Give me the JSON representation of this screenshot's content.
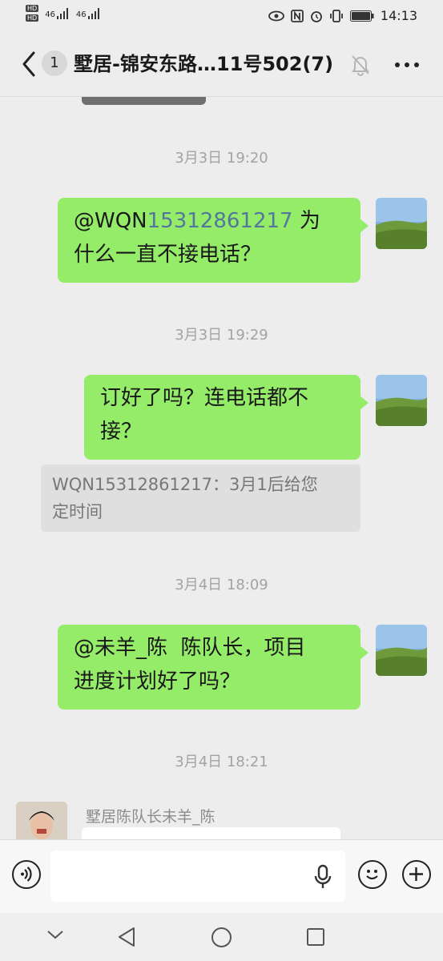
{
  "status_bar": {
    "hd1": "HD",
    "hd2": "HD",
    "signal1": "46",
    "signal2": "46",
    "time": "14:13"
  },
  "nav": {
    "unread_count": "1",
    "title": "墅居-锦安东路…11号502(7)"
  },
  "messages": [
    {
      "type": "time",
      "text": "3月3日 19:20"
    },
    {
      "type": "outgoing",
      "mention": "@WQN",
      "mention_number": "15312861217",
      "text_line1_rest": " 为",
      "text_line2": "什么一直不接电话？"
    },
    {
      "type": "time",
      "text": "3月3日 19:29"
    },
    {
      "type": "outgoing",
      "text_line1": "订好了吗？连电话都不",
      "text_line2": "接？"
    },
    {
      "type": "quote",
      "line1": "WQN15312861217：3月1后给您",
      "line2": "定时间"
    },
    {
      "type": "time",
      "text": "3月4日 18:09"
    },
    {
      "type": "outgoing",
      "text_line1": "@未羊_陈  陈队长，项目",
      "text_line2": "进度计划好了吗？"
    },
    {
      "type": "time",
      "text": "3月4日 18:21"
    },
    {
      "type": "incoming",
      "sender": "墅居陈队长未羊_陈"
    }
  ],
  "input": {
    "placeholder": "",
    "value": ""
  },
  "icons": {
    "back": "chevron-left-icon",
    "mute": "bell-off-icon",
    "more": "more-dots-icon",
    "voice": "voice-mode-icon",
    "mic": "microphone-icon",
    "emoji": "emoji-icon",
    "plus": "plus-icon",
    "sys_hide": "chevron-down-icon",
    "sys_back": "triangle-back-icon",
    "sys_home": "circle-home-icon",
    "sys_recent": "square-recent-icon"
  },
  "colors": {
    "outgoing_bubble": "#95ec69",
    "mention_number": "#53769c",
    "background": "#ededed"
  }
}
